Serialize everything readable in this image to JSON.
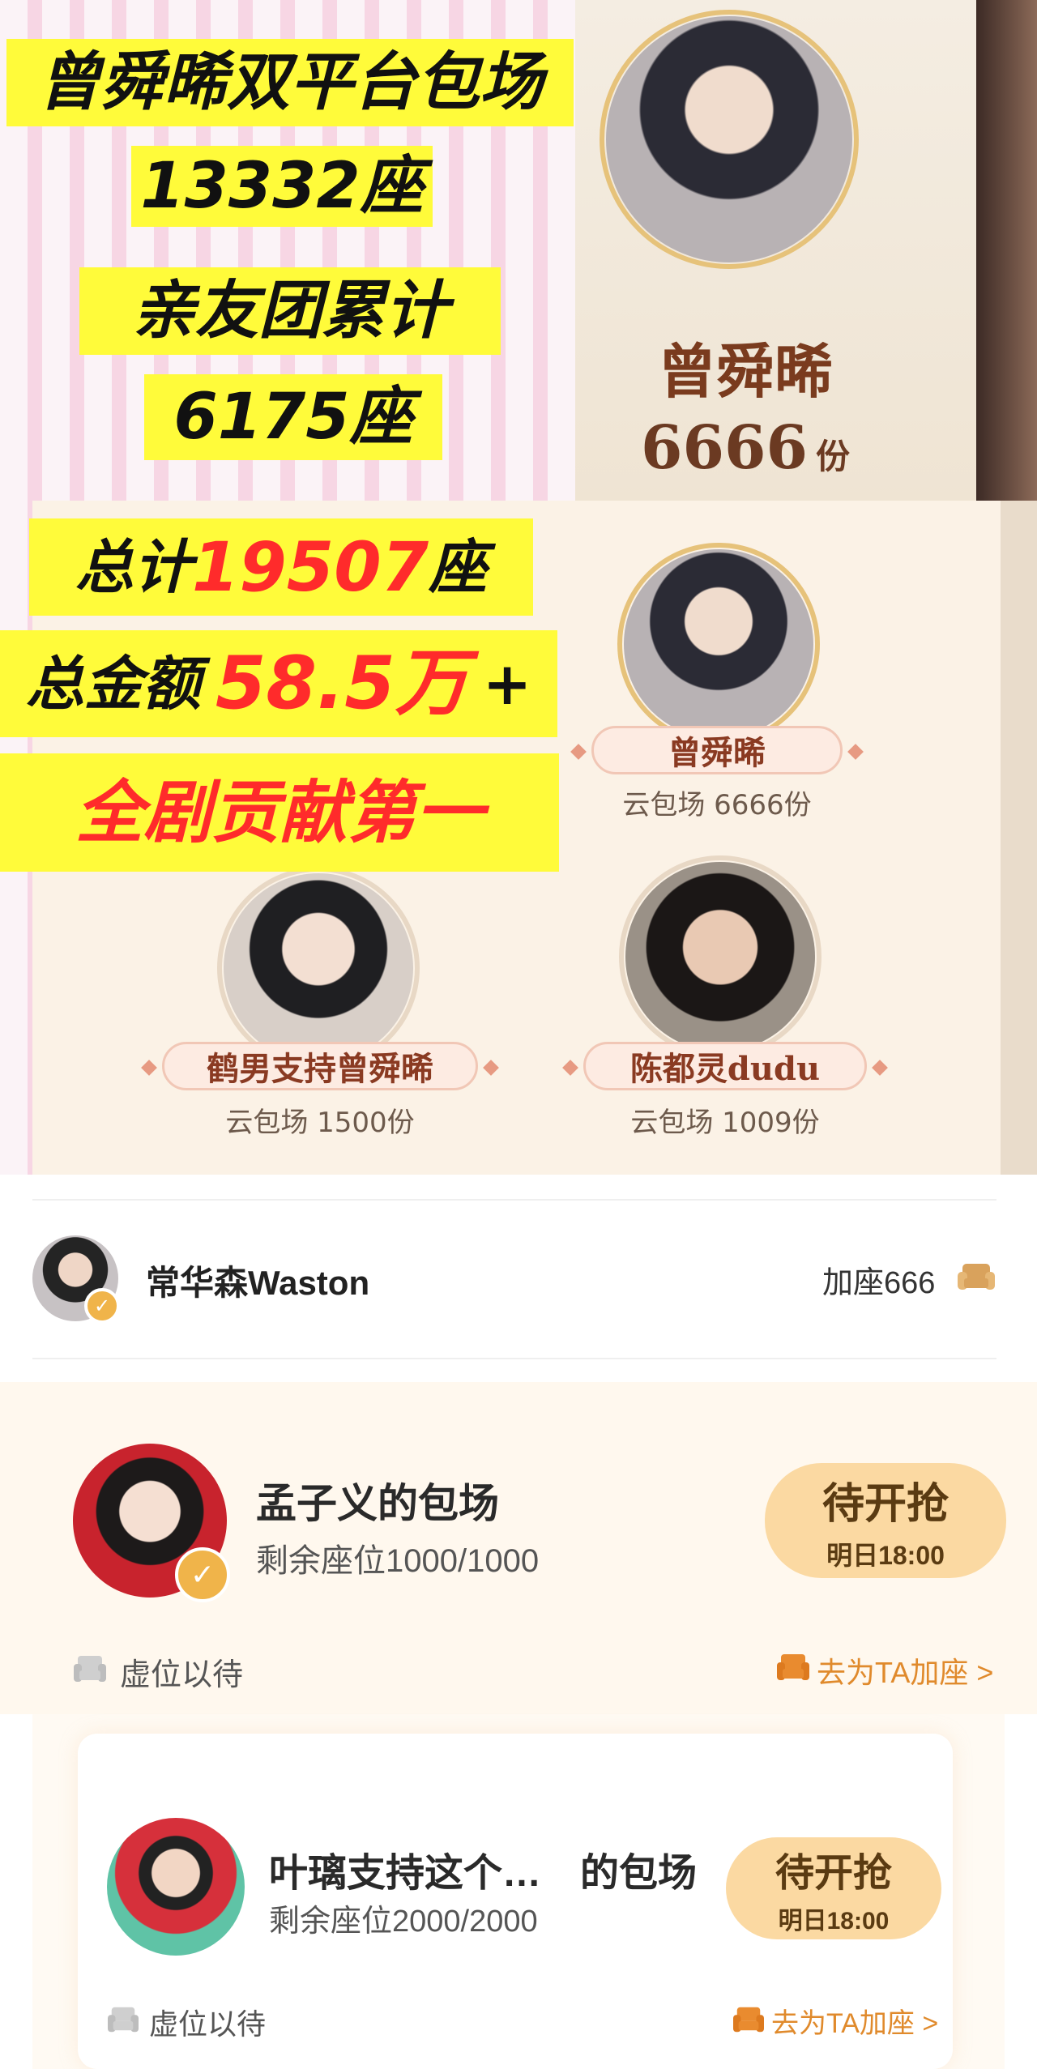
{
  "poster": {
    "headline_1": "曾舜晞双平台包场",
    "headline_2": "13332座",
    "headline_3": "亲友团累计",
    "headline_4": "6175座",
    "total_prefix": "总计",
    "total_value": "19507",
    "total_suffix": "座",
    "amount_prefix": "总金额",
    "amount_value": "58.5万",
    "amount_suffix": "+",
    "ranking": "全剧贡献第一",
    "top_card": {
      "name": "曾舜晞",
      "count": "6666",
      "unit": "份"
    },
    "contributors": [
      {
        "name": "曾舜晞",
        "detail": "云包场 6666份"
      },
      {
        "name": "鹤男支持曾舜晞",
        "detail": "云包场 1500份"
      },
      {
        "name": "陈都灵dudu",
        "detail": "云包场 1009份"
      }
    ],
    "colors": {
      "highlight": "#fffb3a",
      "accent_red": "#ff2b2b"
    }
  },
  "host": {
    "name": "常华森Waston",
    "add_seat": "加座666",
    "icon": "sofa-icon"
  },
  "sessions": [
    {
      "title": "孟子义的包场",
      "seats": "剩余座位1000/1000",
      "status": "待开抢",
      "time": "明日18:00",
      "left_action": "虚位以待",
      "right_action": "去为TA加座 >"
    },
    {
      "title": "叶璃支持这个…　的包场",
      "seats": "剩余座位2000/2000",
      "status": "待开抢",
      "time": "明日18:00",
      "left_action": "虚位以待",
      "right_action": "去为TA加座 >"
    }
  ],
  "colors": {
    "pill": "#fbd9a2",
    "link": "#e08a2c",
    "card_bg": "#fff8ee"
  }
}
